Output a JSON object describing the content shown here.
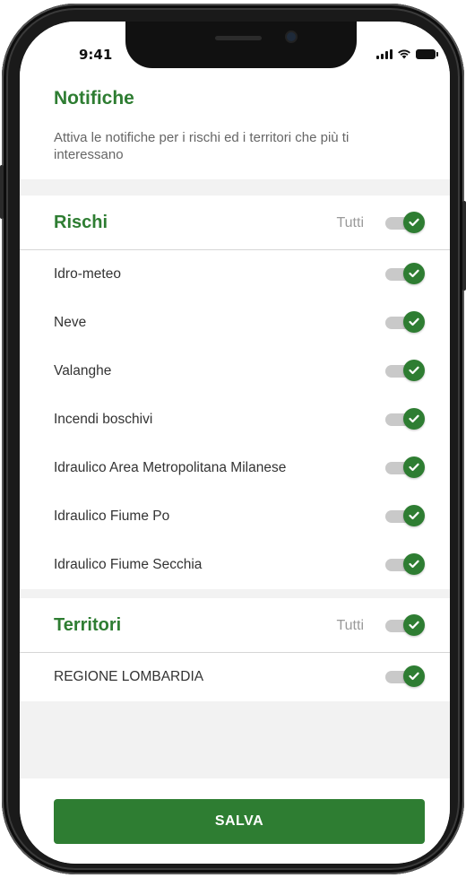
{
  "status": {
    "time": "9:41"
  },
  "header": {
    "title": "Notifiche",
    "description": "Attiva le notifiche per i rischi ed i territori che più ti interessano"
  },
  "rischi": {
    "title": "Rischi",
    "all_label": "Tutti",
    "all_enabled": true,
    "items": [
      {
        "label": "Idro-meteo",
        "enabled": true
      },
      {
        "label": "Neve",
        "enabled": true
      },
      {
        "label": "Valanghe",
        "enabled": true
      },
      {
        "label": "Incendi boschivi",
        "enabled": true
      },
      {
        "label": "Idraulico Area Metropolitana Milanese",
        "enabled": true
      },
      {
        "label": "Idraulico Fiume Po",
        "enabled": true
      },
      {
        "label": "Idraulico Fiume Secchia",
        "enabled": true
      }
    ]
  },
  "territori": {
    "title": "Territori",
    "all_label": "Tutti",
    "all_enabled": true,
    "items": [
      {
        "label": "REGIONE LOMBARDIA",
        "enabled": true
      }
    ]
  },
  "footer": {
    "save_label": "SALVA"
  },
  "colors": {
    "accent": "#2e7d32",
    "track": "#c9c9c9",
    "background": "#f2f2f2"
  },
  "icons": [
    "check-icon",
    "signal-icon",
    "wifi-icon",
    "battery-icon"
  ]
}
